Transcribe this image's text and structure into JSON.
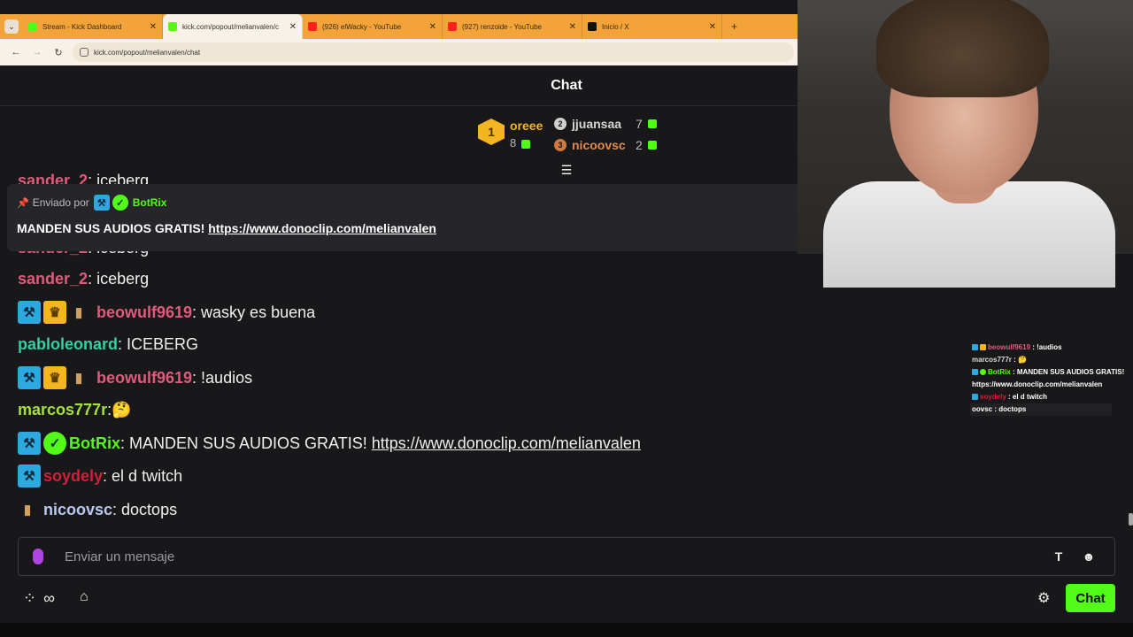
{
  "browser": {
    "tabs": [
      {
        "title": "Stream - Kick Dashboard",
        "favicon_color": "#53fc18",
        "active": false
      },
      {
        "title": "kick.com/popout/melianvalen/c",
        "favicon_color": "#53fc18",
        "active": true
      },
      {
        "title": "(926) elWacky - YouTube",
        "favicon_color": "#ff2020",
        "active": false
      },
      {
        "title": "(927) renzoide - YouTube",
        "favicon_color": "#ff2020",
        "active": false
      },
      {
        "title": "Inicio / X",
        "favicon_color": "#111111",
        "active": false
      }
    ],
    "tab_menu_glyph": "⌄",
    "close_glyph": "✕",
    "new_tab_glyph": "+",
    "back_glyph": "←",
    "forward_glyph": "→",
    "reload_glyph": "↻",
    "url": "kick.com/popout/melianvalen/chat"
  },
  "chat": {
    "title": "Chat",
    "leaderboard": {
      "first": {
        "rank": "1",
        "name": "oreee",
        "count": "8"
      },
      "others": [
        {
          "rank": "2",
          "name": "jjuansaa",
          "count": "7",
          "color": "#d6d6d6",
          "rank_bg": "#cfcfcf"
        },
        {
          "rank": "3",
          "name": "nicoovsc",
          "count": "2",
          "color": "#e08a4f",
          "rank_bg": "#d07a40"
        }
      ]
    },
    "pinned": {
      "sent_by": "Enviado por",
      "user": "BotRix",
      "text": "MANDEN SUS AUDIOS GRATIS!",
      "link": "https://www.donoclip.com/melianvalen"
    },
    "messages_top_partial": [
      {
        "user": "sander_2",
        "text": ": iceberg"
      },
      {
        "user": "sander_2",
        "text": ": iceberg"
      }
    ],
    "messages": [
      {
        "user": "sander_2",
        "text": ": iceberg",
        "color": "#e05a7c",
        "badges": []
      },
      {
        "user": "beowulf9619",
        "text": ": wasky es buena",
        "color": "#e05a7c",
        "badges": [
          "mod",
          "crown",
          "sub"
        ]
      },
      {
        "user": "pabloleonard",
        "text": ": ICEBERG",
        "color": "#30d0a0",
        "badges": []
      },
      {
        "user": "beowulf9619",
        "text": ": !audios",
        "color": "#e05a7c",
        "badges": [
          "mod",
          "crown",
          "sub"
        ]
      },
      {
        "user": "marcos777r",
        "text": ": ",
        "color": "#a8e03a",
        "badges": [],
        "emoji": "🤔"
      },
      {
        "user": "BotRix",
        "text": ": MANDEN SUS AUDIOS GRATIS! ",
        "color": "#53fc18",
        "badges": [
          "mod",
          "verified"
        ],
        "link": "https://www.donoclip.com/melianvalen"
      },
      {
        "user": "soydely",
        "text": ": el d twitch",
        "color": "#d0203a",
        "badges": [
          "mod"
        ]
      },
      {
        "user": "nicoovsc",
        "text": ": doctops",
        "color": "#b8c8f0",
        "badges": [
          "sub"
        ]
      }
    ],
    "input_placeholder": "Enviar un mensaje",
    "send_button": "Chat",
    "infinity_glyph": "∞",
    "store_glyph": "⌂",
    "gear_glyph": "⚙",
    "translate_glyph": "T",
    "emoji_glyph": "☻"
  },
  "overlay": {
    "lines": [
      {
        "user": "beowulf9619",
        "text": " : !audios",
        "color": "#e05a7c"
      },
      {
        "user": "marcos777r",
        "text": " : 🤔",
        "color": "#a8e03a"
      },
      {
        "user": "BotRix",
        "text": " : MANDEN SUS AUDIOS GRATIS!",
        "color": "#53fc18"
      },
      {
        "user": "",
        "text": "https://www.donoclip.com/melianvalen",
        "color": "#ffffff"
      },
      {
        "user": "soydely",
        "text": " : el d twitch",
        "color": "#d0203a"
      },
      {
        "user": "oovsc",
        "text": " : doctops",
        "color": "#ffffff"
      }
    ]
  },
  "colors": {
    "accent": "#53fc18",
    "mod_badge": "#2fa8e0",
    "gold": "#f3b520",
    "mic": "#b044e0"
  }
}
